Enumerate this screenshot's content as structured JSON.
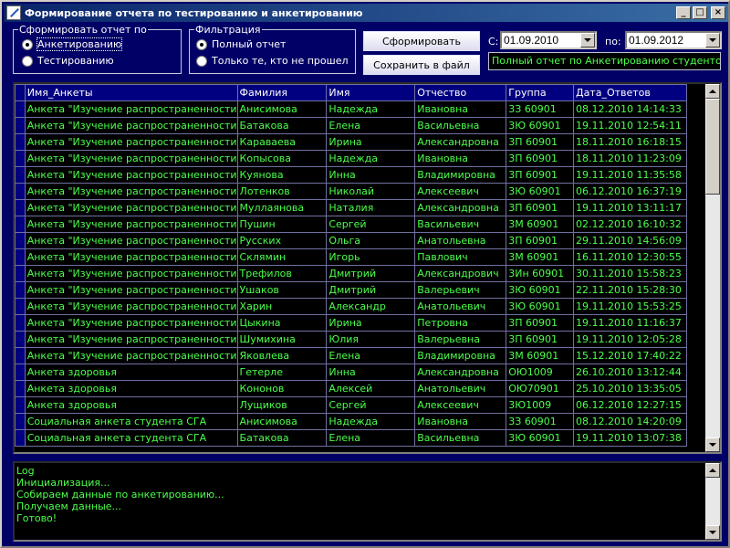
{
  "window": {
    "title": "Формирование отчета по тестированию и анкетированию",
    "minimize": "_",
    "maximize": "□",
    "close": "×"
  },
  "report_by": {
    "legend": "Сформировать отчет по",
    "options": [
      {
        "label": "Анкетированию",
        "checked": true
      },
      {
        "label": "Тестированию",
        "checked": false
      }
    ]
  },
  "filter": {
    "legend": "Фильтрация",
    "options": [
      {
        "label": "Полный отчет",
        "checked": true
      },
      {
        "label": "Только те, кто не прошел",
        "checked": false
      }
    ]
  },
  "actions": {
    "generate": "Сформировать",
    "save": "Сохранить в файл"
  },
  "date_range": {
    "from_label": "С:",
    "from_value": "01.09.2010",
    "to_label": "по:",
    "to_value": "01.09.2012"
  },
  "status_text": "Полный отчет по Анкетированию студентов",
  "table": {
    "columns": [
      "Имя_Анкеты",
      "Фамилия",
      "Имя",
      "Отчество",
      "Группа",
      "Дата_Ответов"
    ],
    "rows": [
      [
        "Анкета \"Изучение распространенности",
        "Анисимова",
        "Надежда",
        "Ивановна",
        "3З 60901",
        "08.12.2010 14:14:33"
      ],
      [
        "Анкета \"Изучение распространенности",
        "Батакова",
        "Елена",
        "Васильевна",
        "3Ю 60901",
        "19.11.2010 12:54:11"
      ],
      [
        "Анкета \"Изучение распространенности",
        "Караваева",
        "Ирина",
        "Александровна",
        "3П 60901",
        "18.11.2010 16:18:15"
      ],
      [
        "Анкета \"Изучение распространенности",
        "Копысова",
        "Надежда",
        "Ивановна",
        "3П 60901",
        "18.11.2010 11:23:09"
      ],
      [
        "Анкета \"Изучение распространенности",
        "Куянова",
        "Инна",
        "Владимировна",
        "3П 60901",
        "19.11.2010 11:35:58"
      ],
      [
        "Анкета \"Изучение распространенности",
        "Лотенков",
        "Николай",
        "Алексеевич",
        "3Ю 60901",
        "06.12.2010 16:37:19"
      ],
      [
        "Анкета \"Изучение распространенности",
        "Муллаянова",
        "Наталия",
        "Александровна",
        "3П 60901",
        "19.11.2010 13:11:17"
      ],
      [
        "Анкета \"Изучение распространенности",
        "Пушин",
        "Сергей",
        "Васильевич",
        "3М 60901",
        "02.12.2010 16:10:32"
      ],
      [
        "Анкета \"Изучение распространенности",
        "Русских",
        "Ольга",
        "Анатольевна",
        "3П 60901",
        "29.11.2010 14:56:09"
      ],
      [
        "Анкета \"Изучение распространенности",
        "Склямин",
        "Игорь",
        "Павлович",
        "3М 60901",
        "16.11.2010 12:30:55"
      ],
      [
        "Анкета \"Изучение распространенности",
        "Трефилов",
        "Дмитрий",
        "Александрович",
        "3Ин 60901",
        "30.11.2010 15:58:23"
      ],
      [
        "Анкета \"Изучение распространенности",
        "Ушаков",
        "Дмитрий",
        "Валерьевич",
        "3Ю 60901",
        "22.11.2010 15:28:30"
      ],
      [
        "Анкета \"Изучение распространенности",
        "Харин",
        "Александр",
        "Анатольевич",
        "3Ю 60901",
        "19.11.2010 15:53:25"
      ],
      [
        "Анкета \"Изучение распространенности",
        "Цыкина",
        "Ирина",
        "Петровна",
        "3П 60901",
        "19.11.2010 11:16:37"
      ],
      [
        "Анкета \"Изучение распространенности",
        "Шумихина",
        "Юлия",
        "Валерьевна",
        "3П 60901",
        "19.11.2010 12:05:28"
      ],
      [
        "Анкета \"Изучение распространенности",
        "Яковлева",
        "Елена",
        "Владимировна",
        "3М 60901",
        "15.12.2010 17:40:22"
      ],
      [
        "Анкета здоровья",
        "Гетерле",
        "Инна",
        "Александровна",
        "ОЮ1009",
        "26.10.2010 13:12:44"
      ],
      [
        "Анкета здоровья",
        "Кононов",
        "Алексей",
        "Анатольевич",
        "ОЮ70901",
        "25.10.2010 13:35:05"
      ],
      [
        "Анкета здоровья",
        "Лущиков",
        "Сергей",
        "Алексеевич",
        "3Ю1009",
        "06.12.2010 12:27:15"
      ],
      [
        "Социальная анкета студента СГА",
        "Анисимова",
        "Надежда",
        "Ивановна",
        "3З 60901",
        "08.12.2010 14:20:09"
      ],
      [
        "Социальная анкета студента СГА",
        "Батакова",
        "Елена",
        "Васильевна",
        "3Ю 60901",
        "19.11.2010 13:07:38"
      ]
    ]
  },
  "log": {
    "lines": [
      "Log",
      "Инициализация...",
      "Собираем данные по анкетированию...",
      "Получаем данные...",
      "Готово!"
    ]
  },
  "colors": {
    "background": "#000066",
    "grid_text": "#4cff4c",
    "header_bg": "#000080"
  }
}
